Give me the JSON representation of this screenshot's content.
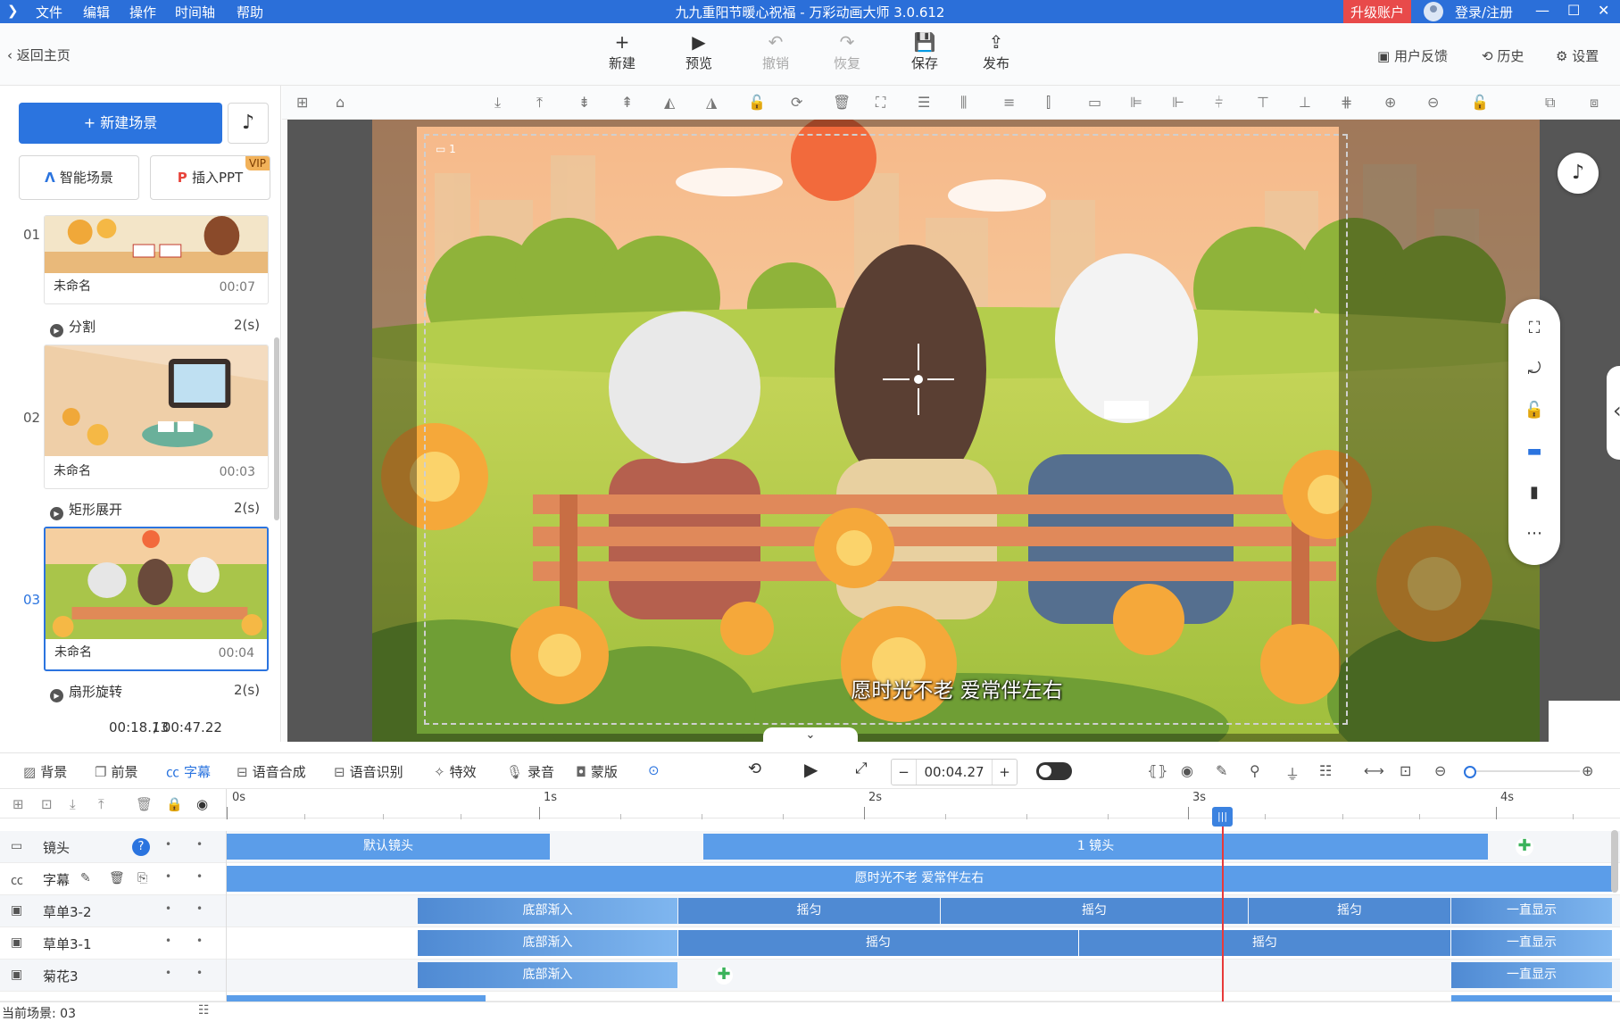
{
  "titlebar": {
    "menus": [
      "文件",
      "编辑",
      "操作",
      "时间轴",
      "帮助"
    ],
    "title": "九九重阳节暖心祝福 - 万彩动画大师 3.0.612",
    "upgrade": "升级账户",
    "login": "登录/注册",
    "win": {
      "min": "—",
      "max": "☐",
      "close": "✕"
    }
  },
  "toolbar": {
    "back": "返回主页",
    "buttons": [
      {
        "label": "新建",
        "icon": "+"
      },
      {
        "label": "预览",
        "icon": "▶"
      },
      {
        "label": "撤销",
        "icon": "↶"
      },
      {
        "label": "恢复",
        "icon": "↷"
      },
      {
        "label": "保存",
        "icon": "💾"
      },
      {
        "label": "发布",
        "icon": "⇪"
      }
    ],
    "right": [
      "用户反馈",
      "历史",
      "设置"
    ]
  },
  "left": {
    "new_scene": "新建场景",
    "smart_scene": "智能场景",
    "insert_ppt": "插入PPT",
    "vip": "VIP",
    "scenes": [
      {
        "num": "01",
        "name": "未命名",
        "time": "00:07"
      },
      {
        "num": "02",
        "name": "未命名",
        "time": "00:03"
      },
      {
        "num": "03",
        "name": "未命名",
        "time": "00:04"
      }
    ],
    "transitions": [
      {
        "name": "分割",
        "dur": "2(s)"
      },
      {
        "name": "矩形展开",
        "dur": "2(s)"
      },
      {
        "name": "扇形旋转",
        "dur": "2(s)"
      }
    ],
    "time_current": "00:18.13",
    "time_total": "/ 00:47.22"
  },
  "stage": {
    "caption": "愿时光不老 爱常伴左右",
    "camera_label": "1"
  },
  "bottom_tabs": [
    "背景",
    "前景",
    "字幕",
    "语音合成",
    "语音识别",
    "特效",
    "录音",
    "蒙版"
  ],
  "time_input": {
    "value": "00:04.27",
    "minus": "−",
    "plus": "+"
  },
  "timeline": {
    "ticks": [
      "0s",
      "1s",
      "2s",
      "3s",
      "4s"
    ],
    "rows": [
      {
        "label": "镜头",
        "blocks": [
          "默认镜头",
          "1 镜头"
        ]
      },
      {
        "label": "字幕",
        "blocks": [
          "愿时光不老 爱常伴左右"
        ]
      },
      {
        "label": "草单3-2",
        "blocks": [
          "底部渐入",
          "摇匀",
          "摇匀",
          "摇匀",
          "一直显示"
        ]
      },
      {
        "label": "草单3-1",
        "blocks": [
          "底部渐入",
          "摇匀",
          "摇匀",
          "一直显示"
        ]
      },
      {
        "label": "菊花3",
        "blocks": [
          "底部渐入",
          "一直显示"
        ]
      }
    ],
    "playhead_time": "00:04.27"
  },
  "status": {
    "current_scene": "当前场景: 03"
  },
  "colors": {
    "accent": "#2b74df",
    "titlebar": "#2b6fd9",
    "block": "#5b9de9",
    "playhead": "#e83a3a"
  }
}
